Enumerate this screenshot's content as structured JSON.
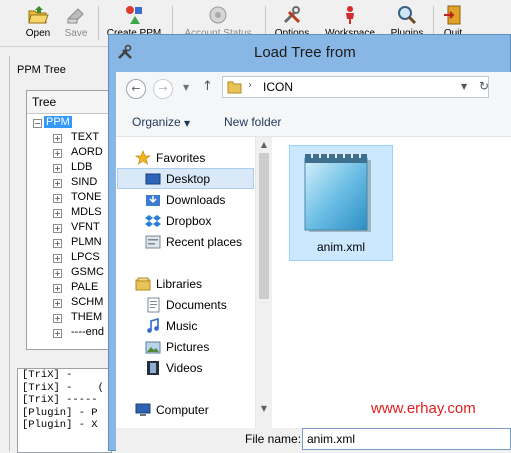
{
  "toolbar": {
    "open_label": "Open",
    "save_label": "Save",
    "create_ppm_label": "Create PPM",
    "account_status_label": "Account Status",
    "options_label": "Options",
    "workspace_label": "Workspace",
    "plugins_label": "Plugins",
    "quit_label": "Quit"
  },
  "ppm_tree": {
    "panel_label": "PPM Tree",
    "column_header": "Tree",
    "root": "PPM",
    "nodes": [
      "TEXT",
      "AORD",
      "LDB",
      "SIND",
      "TONE",
      "MDLS",
      "VFNT",
      "PLMN",
      "LPCS",
      "GSMC",
      "PALE",
      "SCHM",
      "THEM",
      "----end"
    ]
  },
  "log": {
    "lines": [
      "[TriX] -",
      "[TriX] -    (",
      "[TriX] -----",
      "",
      "[Plugin] - P",
      "[Plugin] - X"
    ]
  },
  "dialog": {
    "title": "Load Tree from",
    "address": {
      "path": "ICON"
    },
    "commands": {
      "organize": "Organize",
      "new_folder": "New folder"
    },
    "nav": {
      "favorites_header": "Favorites",
      "desktop": "Desktop",
      "downloads": "Downloads",
      "dropbox": "Dropbox",
      "recent_places": "Recent places",
      "libraries_header": "Libraries",
      "documents": "Documents",
      "music": "Music",
      "pictures": "Pictures",
      "videos": "Videos",
      "computer_header": "Computer"
    },
    "files": [
      {
        "name": "anim.xml",
        "icon": "notepad-document-icon"
      }
    ],
    "footer": {
      "file_name_label": "File name:",
      "file_name_value": "anim.xml"
    }
  },
  "watermark": "www.erhay.com",
  "colors": {
    "selection_blue": "#3399ff",
    "dialog_frame": "#88b7e5",
    "selected_item": "#cce8ff",
    "watermark_red": "#e32020"
  }
}
